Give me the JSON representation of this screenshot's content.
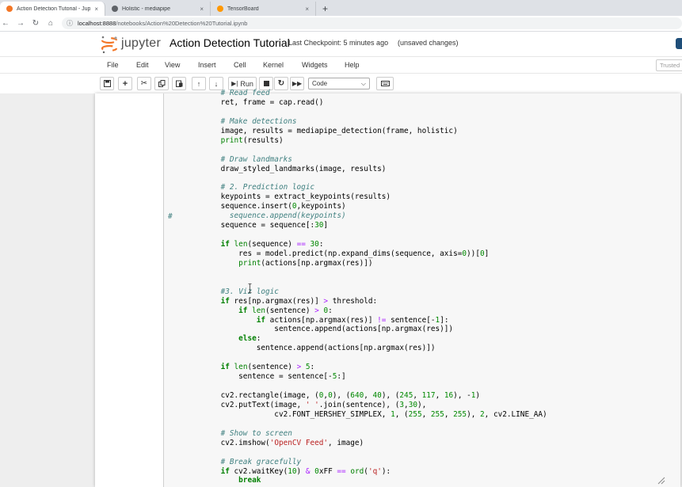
{
  "browser": {
    "tabs": [
      {
        "title": "Action Detection Tutorial - Jupyter",
        "color": "#f37626",
        "active": true
      },
      {
        "title": "Holistic - mediapipe",
        "color": "#5f6368",
        "active": false
      },
      {
        "title": "TensorBoard",
        "color": "#ff9800",
        "active": false
      }
    ],
    "close_glyph": "×",
    "newtab_glyph": "+",
    "url_host": "localhost:8888",
    "url_path": "/notebooks/Action%20Detection%20Tutorial.ipynb"
  },
  "jupyter": {
    "logo_text": "jupyter",
    "notebook_title": "Action Detection Tutorial",
    "checkpoint": "Last Checkpoint: 5 minutes ago",
    "unsaved": "(unsaved changes)",
    "menu": [
      "File",
      "Edit",
      "View",
      "Insert",
      "Cell",
      "Kernel",
      "Widgets",
      "Help"
    ],
    "trusted": "Trusted",
    "run_label": "Run",
    "cell_type": "Code"
  },
  "code_lines": [
    "    # Read feed",
    "    ret, frame = cap.read()",
    "",
    "    # Make detections",
    "    image, results = mediapipe_detection(frame, holistic)",
    "    print(results)",
    "",
    "    # Draw landmarks",
    "    draw_styled_landmarks(image, results)",
    "",
    "    # 2. Prediction logic",
    "    keypoints = extract_keypoints(results)",
    "    sequence.insert(0,keypoints)",
    "      sequence.append(keypoints)",
    "    sequence = sequence[:30]",
    "",
    "    if len(sequence) == 30:",
    "        res = model.predict(np.expand_dims(sequence, axis=0))[0]",
    "        print(actions[np.argmax(res)])",
    "",
    "",
    "    #3. Viz logic",
    "    if res[np.argmax(res)] > threshold:",
    "        if len(sentence) > 0:",
    "            if actions[np.argmax(res)] != sentence[-1]:",
    "                sentence.append(actions[np.argmax(res)])",
    "        else:",
    "            sentence.append(actions[np.argmax(res)])",
    "",
    "    if len(sentence) > 5:",
    "        sentence = sentence[-5:]",
    "",
    "    cv2.rectangle(image, (0,0), (640, 40), (245, 117, 16), -1)",
    "    cv2.putText(image, ' '.join(sentence), (3,30),",
    "                cv2.FONT_HERSHEY_SIMPLEX, 1, (255, 255, 255), 2, cv2.LINE_AA)",
    "",
    "    # Show to screen",
    "    cv2.imshow('OpenCV Feed', image)",
    "",
    "    # Break gracefully",
    "    if cv2.waitKey(10) & 0xFF == ord('q'):",
    "        break"
  ],
  "gutter_comment": "#"
}
